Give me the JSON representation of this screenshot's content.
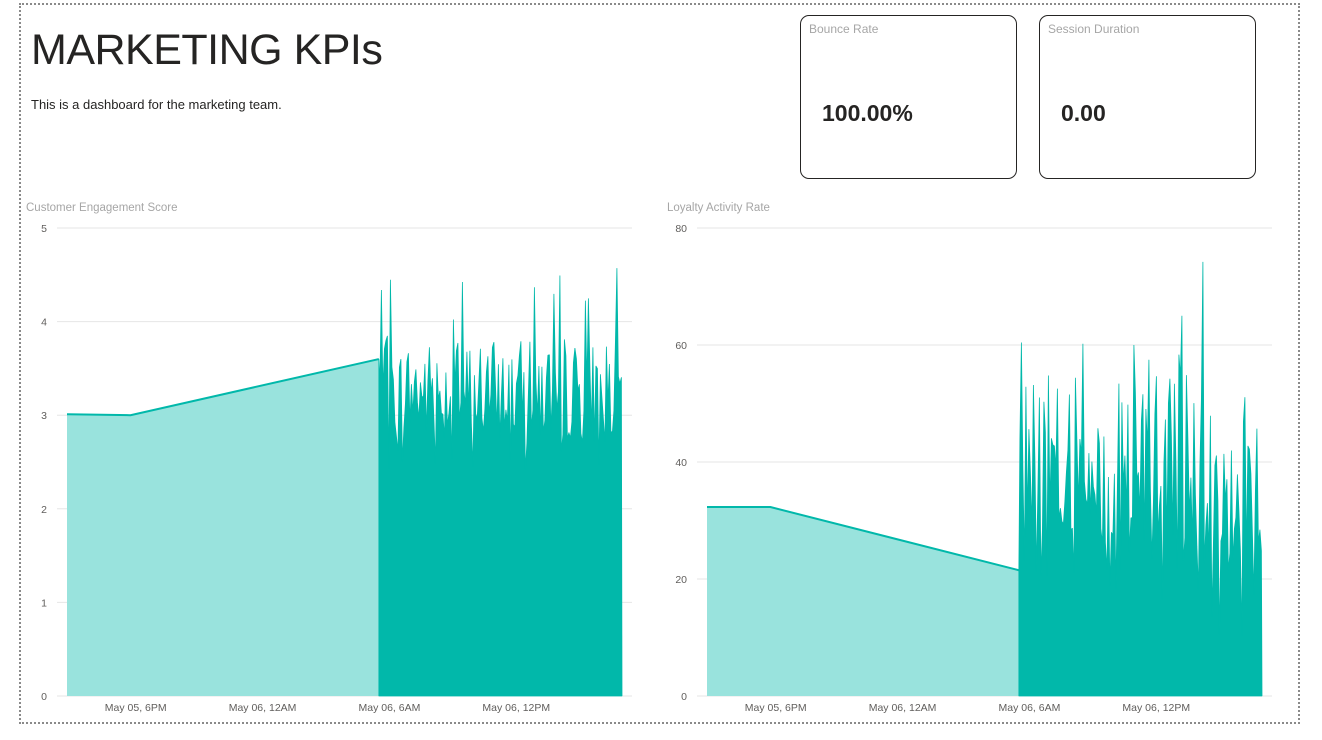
{
  "header": {
    "title": "MARKETING KPIs",
    "subtitle": "This is a dashboard for the marketing team."
  },
  "cards": [
    {
      "label": "Bounce Rate",
      "value": "100.00%"
    },
    {
      "label": "Session Duration",
      "value": "0.00"
    }
  ],
  "colors": {
    "accent": "#01B8AA",
    "fill_light": "#99E3DD",
    "grid": "#E6E6E6"
  },
  "chart_data": [
    {
      "type": "area",
      "title": "Customer Engagement Score",
      "xlabel": "",
      "ylabel": "",
      "ylim": [
        0,
        5
      ],
      "yticks": [
        "0",
        "1",
        "2",
        "3",
        "4",
        "5"
      ],
      "xtick_labels": [
        "May 05, 6PM",
        "May 06, 12AM",
        "May 06, 6AM",
        "May 06, 12PM"
      ],
      "grid": true,
      "series": [
        {
          "points": [
            {
              "x": "May 05, 2:45PM",
              "y": 3.01
            },
            {
              "x": "May 05, 5:45PM",
              "y": 3.0
            },
            {
              "x": "May 06, 5:30AM",
              "y": 3.6
            }
          ],
          "dense_segment": {
            "x_start": "May 06, 5:30AM",
            "x_end": "May 06, 5PM",
            "y_min": 2.4,
            "y_typical_range": [
              2.7,
              3.8
            ],
            "y_max": 4.6
          }
        }
      ]
    },
    {
      "type": "area",
      "title": "Loyalty Activity Rate",
      "xlabel": "",
      "ylabel": "",
      "ylim": [
        0,
        80
      ],
      "yticks": [
        "0",
        "20",
        "40",
        "60",
        "80"
      ],
      "xtick_labels": [
        "May 05, 6PM",
        "May 06, 12AM",
        "May 06, 6AM",
        "May 06, 12PM"
      ],
      "grid": true,
      "series": [
        {
          "points": [
            {
              "x": "May 05, 2:45PM",
              "y": 32.3
            },
            {
              "x": "May 05, 5:45PM",
              "y": 32.3
            },
            {
              "x": "May 06, 5:30AM",
              "y": 21.5
            }
          ],
          "dense_segment": {
            "x_start": "May 06, 5:30AM",
            "x_end": "May 06, 5PM",
            "y_min": 10,
            "y_typical_range": [
              20,
              55
            ],
            "y_max": 77
          }
        }
      ]
    }
  ]
}
